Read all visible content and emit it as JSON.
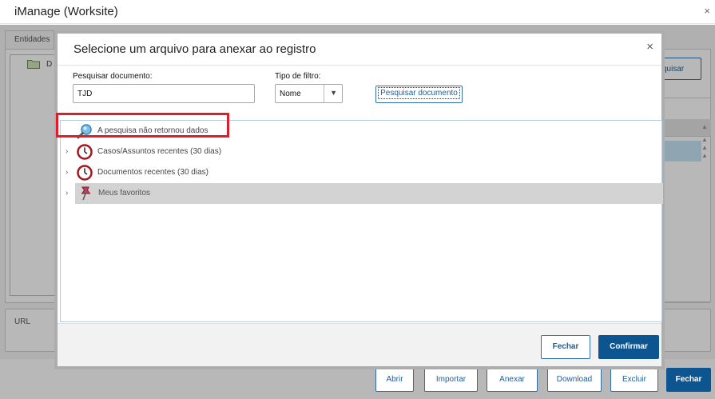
{
  "window": {
    "title": "iManage (Worksite)",
    "close_glyph": "×"
  },
  "background": {
    "tab_entities": "Entidades",
    "tree_item_initial": "D",
    "search_button_partial": "quisar",
    "url_label": "URL"
  },
  "footer_buttons": [
    {
      "label": "Abrir"
    },
    {
      "label": "Importar"
    },
    {
      "label": "Anexar"
    },
    {
      "label": "Download"
    },
    {
      "label": "Excluir"
    },
    {
      "label": "Fechar"
    }
  ],
  "modal": {
    "title": "Selecione um arquivo para anexar ao registro",
    "close_glyph": "×",
    "search_label": "Pesquisar documento:",
    "search_value": "TJD",
    "filter_label": "Tipo de filtro:",
    "filter_value": "Nome",
    "search_button": "Pesquisar documento",
    "results": [
      {
        "text": "A pesquisa não retornou dados",
        "icon": "magnifier-icon"
      },
      {
        "text": "Casos/Assuntos recentes (30 dias)",
        "icon": "clock-icon"
      },
      {
        "text": "Documentos recentes (30 dias)",
        "icon": "clock-icon"
      },
      {
        "text": "Meus favoritos",
        "icon": "pushpin-icon"
      }
    ],
    "close_button": "Fechar",
    "confirm_button": "Confirmar"
  },
  "colors": {
    "accent": "#0d5590",
    "highlight": "#e21c2a",
    "selection": "#c6e5f7"
  }
}
